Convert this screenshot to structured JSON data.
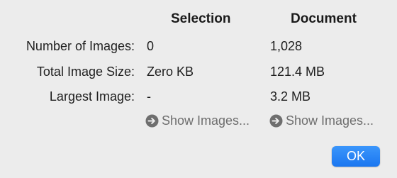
{
  "columns": {
    "selection": "Selection",
    "document": "Document"
  },
  "rows": [
    {
      "label": "Number of Images:",
      "selection": "0",
      "document": "1,028"
    },
    {
      "label": "Total Image Size:",
      "selection": "Zero KB",
      "document": "121.4 MB"
    },
    {
      "label": "Largest Image:",
      "selection": "-",
      "document": "3.2 MB"
    }
  ],
  "actions": {
    "show_images_selection": "Show Images...",
    "show_images_document": "Show Images...",
    "ok": "OK"
  },
  "colors": {
    "background": "#ececec",
    "accent": "#1a76f0",
    "link_gray": "#6e6e6e"
  },
  "icons": {
    "show_images": "arrow-circle-right-icon"
  }
}
